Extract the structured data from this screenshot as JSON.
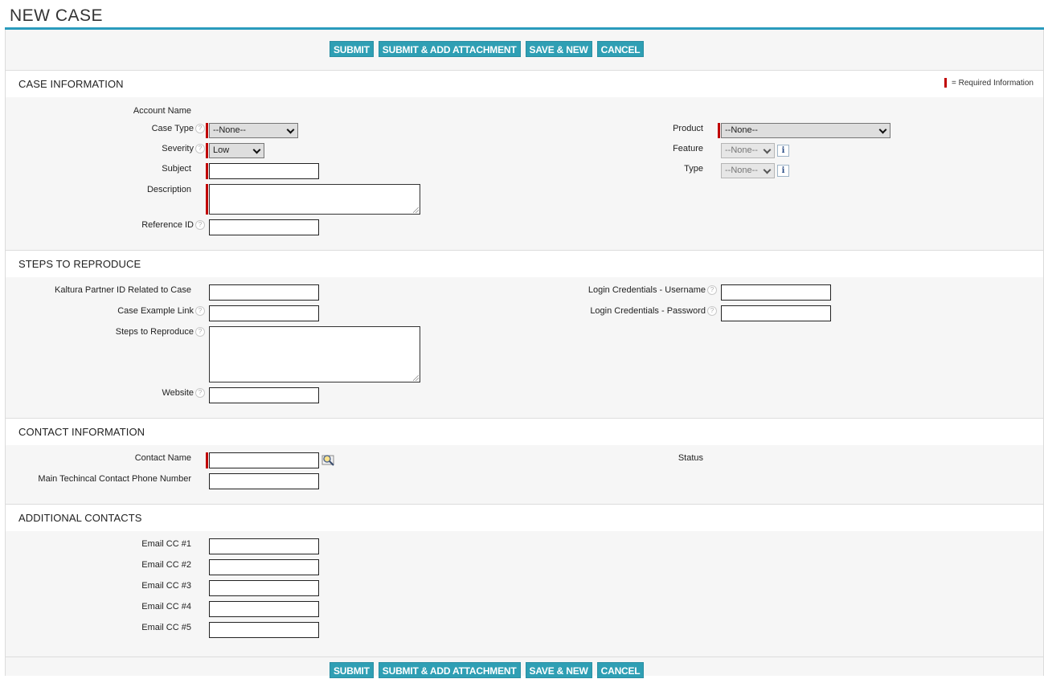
{
  "page": {
    "title": "NEW CASE"
  },
  "buttons": {
    "submit": "SUBMIT",
    "submit_attach": "SUBMIT & ADD ATTACHMENT",
    "save_new": "SAVE & NEW",
    "cancel": "CANCEL"
  },
  "required_legend": "= Required Information",
  "case_info": {
    "heading": "CASE INFORMATION",
    "account_name_label": "Account Name",
    "case_type_label": "Case Type",
    "case_type_value": "--None--",
    "severity_label": "Severity",
    "severity_value": "Low",
    "subject_label": "Subject",
    "description_label": "Description",
    "reference_id_label": "Reference ID",
    "product_label": "Product",
    "product_value": "--None--",
    "feature_label": "Feature",
    "feature_value": "--None--",
    "type_label": "Type",
    "type_value": "--None--"
  },
  "steps": {
    "heading": "STEPS TO REPRODUCE",
    "partner_id_label": "Kaltura Partner ID Related to Case",
    "example_link_label": "Case Example Link",
    "steps_label": "Steps to Reproduce",
    "website_label": "Website",
    "username_label": "Login Credentials - Username",
    "password_label": "Login Credentials - Password"
  },
  "contact": {
    "heading": "CONTACT INFORMATION",
    "contact_name_label": "Contact Name",
    "phone_label": "Main Techincal Contact Phone Number",
    "status_label": "Status"
  },
  "additional": {
    "heading": "ADDITIONAL CONTACTS",
    "cc1": "Email CC #1",
    "cc2": "Email CC #2",
    "cc3": "Email CC #3",
    "cc4": "Email CC #4",
    "cc5": "Email CC #5"
  },
  "icons": {
    "help": "help-icon",
    "info": "info-icon",
    "lookup": "lookup-icon",
    "dropdown": "chevron-down-icon"
  },
  "colors": {
    "accent": "#2a9bbd",
    "button": "#2f9fb4",
    "required": "#c00000"
  }
}
